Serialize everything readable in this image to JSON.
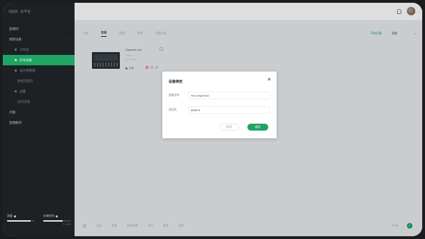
{
  "brand": {
    "name": "云平台"
  },
  "sidebar": {
    "items": [
      {
        "label": "直播间",
        "level": 0,
        "chevron": true
      },
      {
        "label": "视频设备",
        "level": 0,
        "chevron": true
      },
      {
        "label": "工作台",
        "level": 1,
        "chevron": false
      },
      {
        "label": "云导设备",
        "level": 1,
        "chevron": false,
        "active": true
      },
      {
        "label": "设计师管理",
        "level": 1,
        "chevron": true
      },
      {
        "label": "数据流服务",
        "level": 2,
        "chevron": false
      },
      {
        "label": "设置",
        "level": 1,
        "chevron": true
      },
      {
        "label": "操作指南",
        "level": 2,
        "chevron": false
      },
      {
        "label": "点播",
        "level": 0,
        "chevron": true
      },
      {
        "label": "直播翻译",
        "level": 0,
        "chevron": true
      }
    ],
    "footer": {
      "left_label": "流量",
      "left_progress": 0.85,
      "right_label": "存储空间",
      "right_progress": 0.7,
      "right_sub": "1 / 10G"
    }
  },
  "toolbar": {
    "tabs": [
      "全部",
      "在线",
      "离线",
      "异常",
      "设备分组"
    ],
    "active_tab": 1,
    "add_label": "添加设备",
    "filter_value": "全部"
  },
  "device_card": {
    "name": "Channel-1-kt",
    "meta_1": "Video Tv",
    "meta_2": "ID: 10000",
    "status": "在线"
  },
  "footer_bar": {
    "actions": [
      "全选",
      "直播",
      "转码配置",
      "导出",
      "删除",
      "更多"
    ],
    "page_label": "共1条",
    "page_number": "1"
  },
  "dialog": {
    "title": "设备绑定",
    "close_glyph": "×",
    "fields": [
      {
        "label": "设备名称",
        "value": "mini-edge0442"
      },
      {
        "label": "验证码",
        "value": "886678"
      }
    ],
    "cancel_label": "取消",
    "confirm_label": "绑定"
  },
  "colors": {
    "accent": "#1fa463",
    "sidebar_bg": "#1d2124",
    "main_bg": "#e9ecee"
  }
}
